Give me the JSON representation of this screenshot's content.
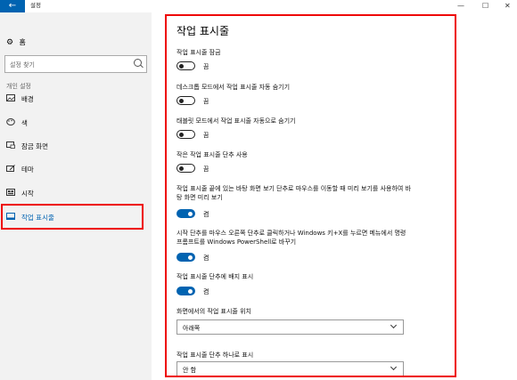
{
  "window": {
    "back_icon": "←",
    "title": "설정",
    "minimize_icon": "—",
    "maximize_icon": "☐",
    "close_icon": "✕"
  },
  "sidebar": {
    "home_label": "홈",
    "search_placeholder": "설정 찾기",
    "section_header": "개인 설정",
    "items": [
      {
        "label": "배경",
        "icon": "picture-icon"
      },
      {
        "label": "색",
        "icon": "palette-icon"
      },
      {
        "label": "잠금 화면",
        "icon": "lock-screen-icon"
      },
      {
        "label": "테마",
        "icon": "brush-icon"
      },
      {
        "label": "시작",
        "icon": "start-icon"
      },
      {
        "label": "작업 표시줄",
        "icon": "taskbar-icon",
        "active": true
      }
    ]
  },
  "main": {
    "title": "작업 표시줄",
    "settings": [
      {
        "label": "작업 표시줄 잠금",
        "state": "끔",
        "on": false
      },
      {
        "label": "데스크톱 모드에서 작업 표시줄 자동 숨기기",
        "state": "끔",
        "on": false
      },
      {
        "label": "태블릿 모드에서 작업 표시줄 자동으로 숨기기",
        "state": "끔",
        "on": false
      },
      {
        "label": "작은 작업 표시줄 단추 사용",
        "state": "끔",
        "on": false
      },
      {
        "label": "작업 표시줄 끝에 있는 바탕 화면 보기 단추로 마우스를 이동할 때 미리 보기를 사용하여 바탕 화면 미리 보기",
        "state": "켬",
        "on": true
      },
      {
        "label": "시작 단추를 마우스 오른쪽 단추로 클릭하거나 Windows 키+X를 누르면 메뉴에서 명령 프롬프트를 Windows PowerShell로 바꾸기",
        "state": "켬",
        "on": true
      },
      {
        "label": "작업 표시줄 단추에 배지 표시",
        "state": "켬",
        "on": true
      }
    ],
    "location": {
      "label": "화면에서의 작업 표시줄 위치",
      "value": "아래쪽"
    },
    "combine": {
      "label": "작업 표시줄 단추 하나로 표시",
      "value": "안 함"
    }
  },
  "colors": {
    "accent": "#0063b1",
    "highlight": "#ee0000",
    "sidebar_bg": "#f2f2f2"
  }
}
